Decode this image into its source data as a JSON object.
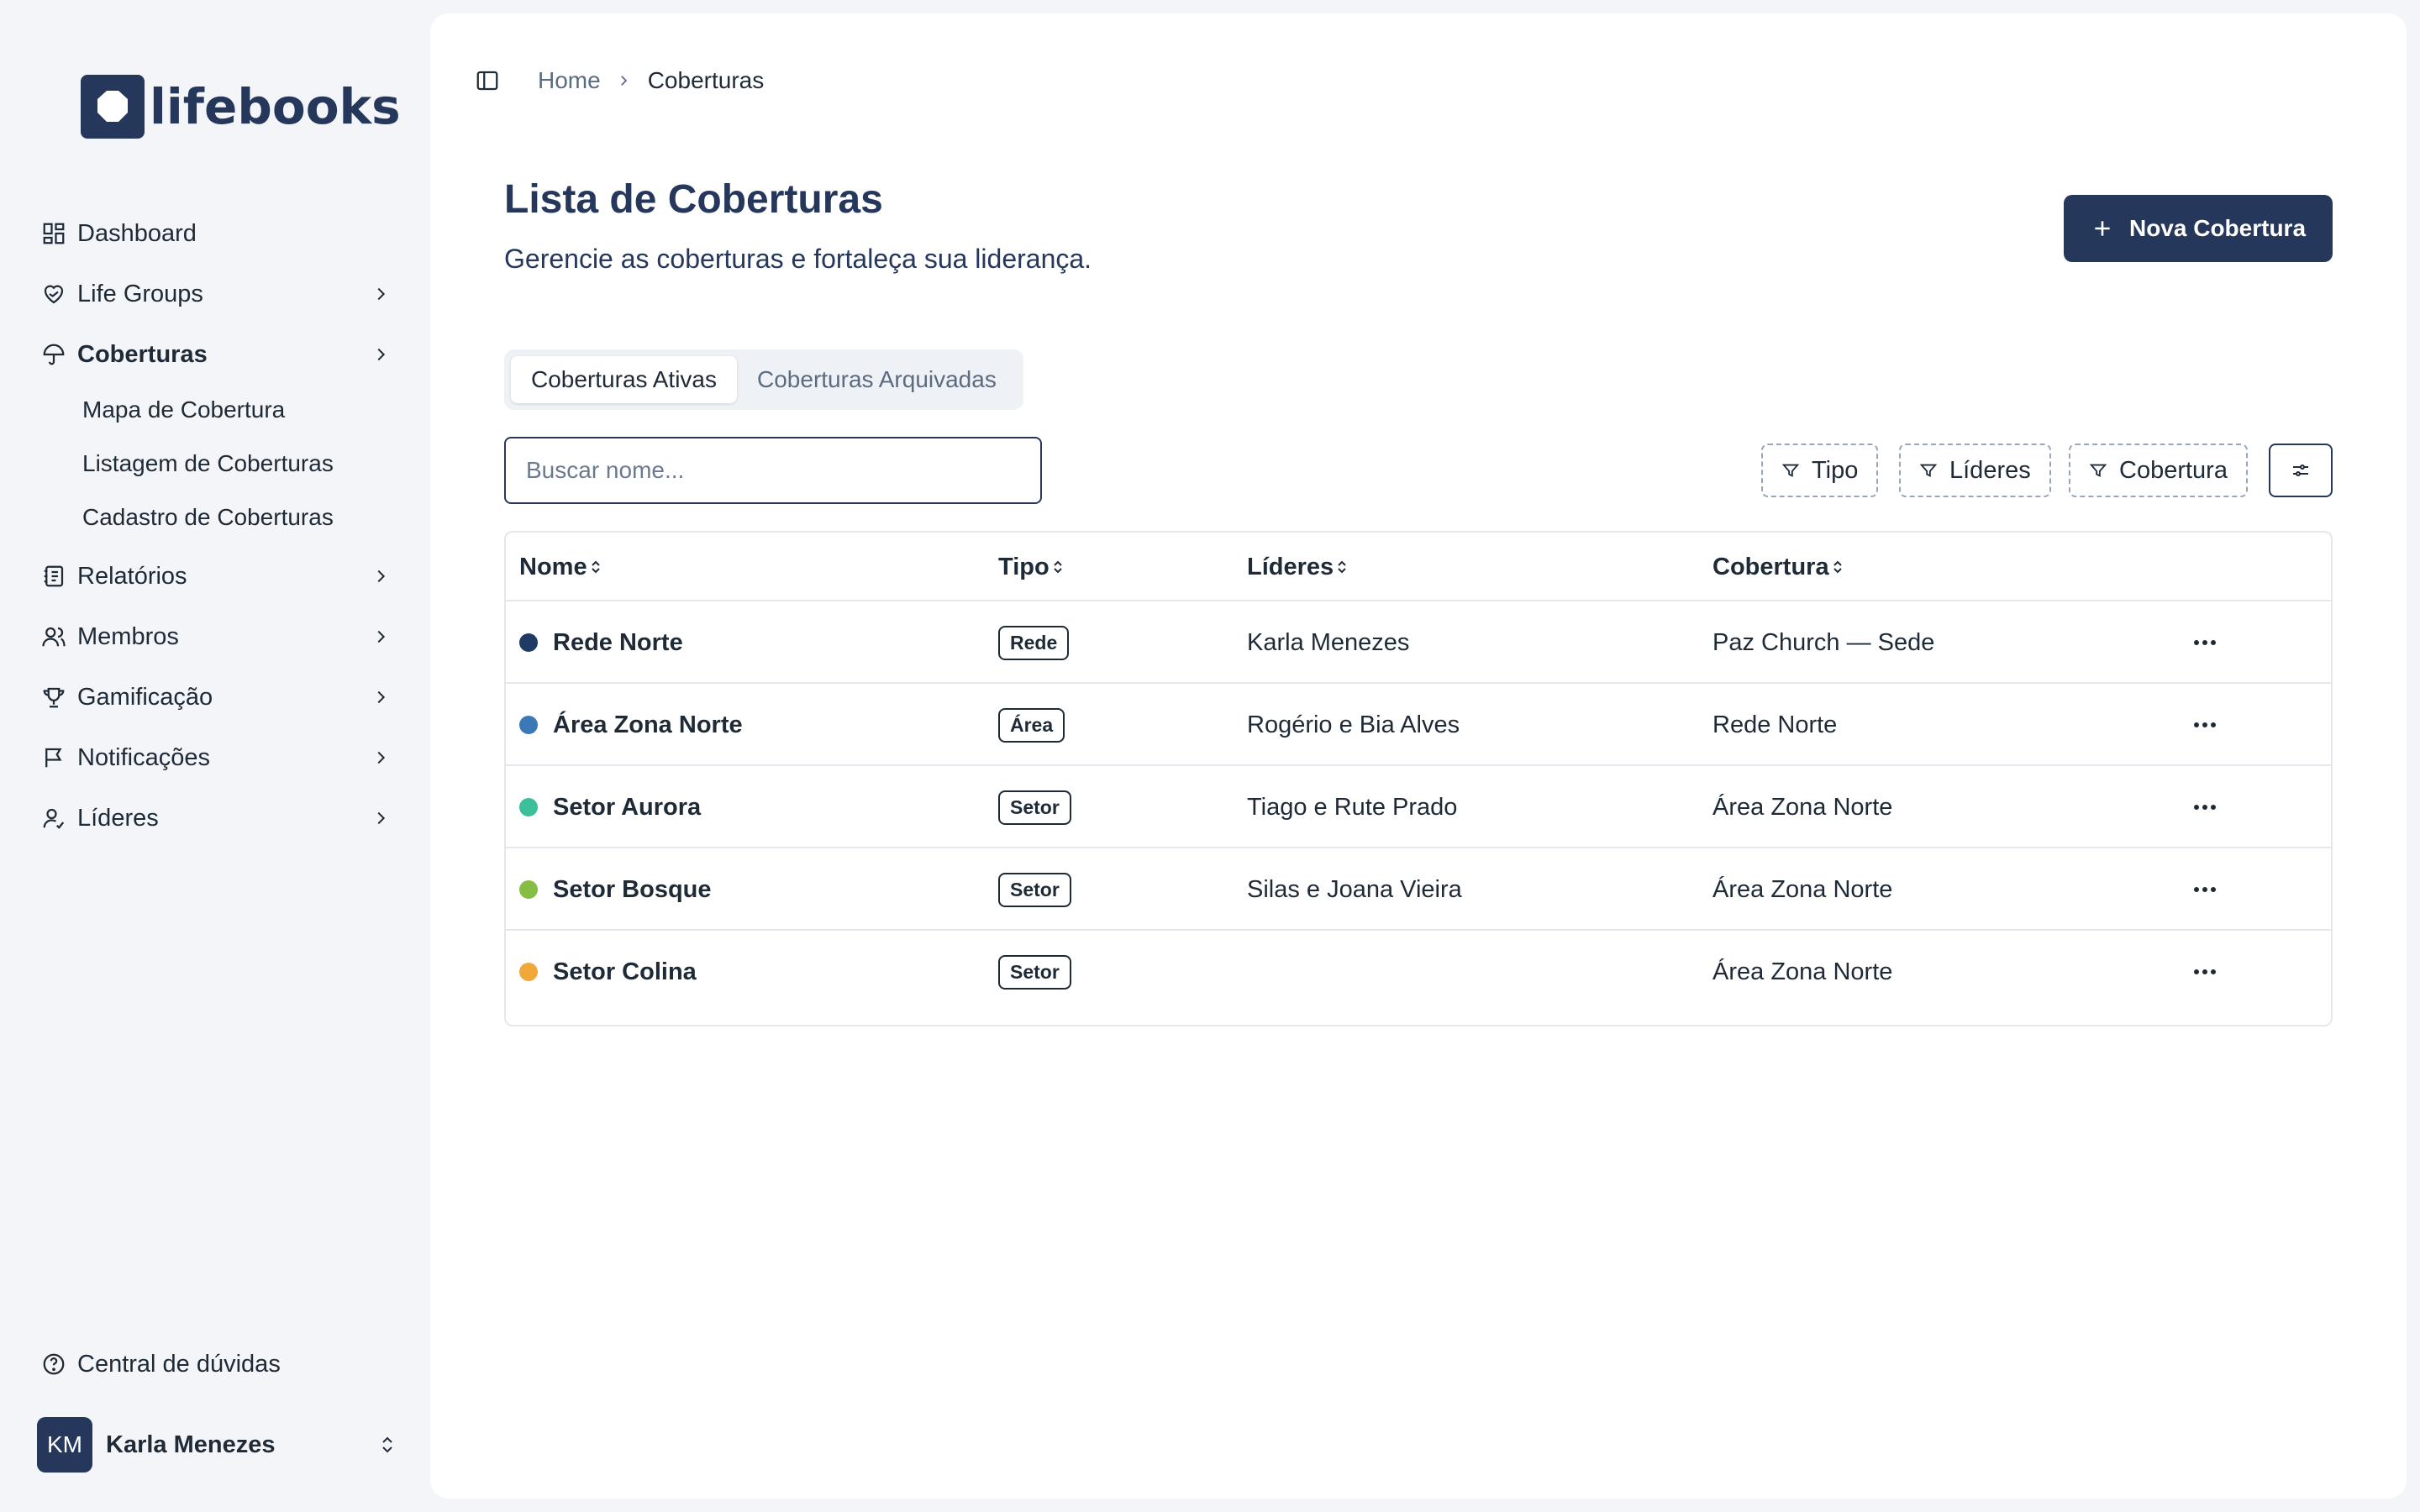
{
  "brand": {
    "name": "lifebooks",
    "color": "#26375c"
  },
  "sidebar": {
    "items": [
      {
        "label": "Dashboard",
        "icon": "dashboard-grid-icon",
        "has_children": false
      },
      {
        "label": "Life Groups",
        "icon": "heart-hands-icon",
        "has_children": true
      },
      {
        "label": "Coberturas",
        "icon": "umbrella-icon",
        "has_children": true,
        "active": true
      },
      {
        "label": "Relatórios",
        "icon": "report-book-icon",
        "has_children": true
      },
      {
        "label": "Membros",
        "icon": "users-icon",
        "has_children": true
      },
      {
        "label": "Gamificação",
        "icon": "trophy-icon",
        "has_children": true
      },
      {
        "label": "Notificações",
        "icon": "flag-message-icon",
        "has_children": true
      },
      {
        "label": "Líderes",
        "icon": "leader-user-icon",
        "has_children": true
      }
    ],
    "sub_items": [
      "Mapa de Cobertura",
      "Listagem de Coberturas",
      "Cadastro de Coberturas"
    ],
    "help_label": "Central de dúvidas",
    "user": {
      "initials": "KM",
      "name": "Karla Menezes"
    }
  },
  "breadcrumb": {
    "home": "Home",
    "current": "Coberturas"
  },
  "page": {
    "title": "Lista de Coberturas",
    "subtitle": "Gerencie as coberturas e fortaleça sua liderança.",
    "new_button": "Nova Cobertura"
  },
  "tabs": {
    "active": "Coberturas Ativas",
    "archived": "Coberturas Arquivadas"
  },
  "search": {
    "placeholder": "Buscar nome...",
    "value": ""
  },
  "filters": [
    "Tipo",
    "Líderes",
    "Cobertura"
  ],
  "table": {
    "columns": [
      "Nome",
      "Tipo",
      "Líderes",
      "Cobertura"
    ],
    "rows": [
      {
        "nome": "Rede Norte",
        "color": "#1f3a63",
        "tipo": "Rede",
        "lideres": "Karla Menezes",
        "cobertura": "Paz Church — Sede"
      },
      {
        "nome": "Área Zona Norte",
        "color": "#3a78b8",
        "tipo": "Área",
        "lideres": "Rogério e Bia Alves",
        "cobertura": "Rede Norte"
      },
      {
        "nome": "Setor Aurora",
        "color": "#3cbf9a",
        "tipo": "Setor",
        "lideres": "Tiago e Rute Prado",
        "cobertura": "Área Zona Norte"
      },
      {
        "nome": "Setor Bosque",
        "color": "#86bd45",
        "tipo": "Setor",
        "lideres": "Silas e Joana Vieira",
        "cobertura": "Área Zona Norte"
      },
      {
        "nome": "Setor Colina",
        "color": "#f2a73b",
        "tipo": "Setor",
        "lideres": "",
        "cobertura": "Área Zona Norte"
      }
    ]
  }
}
